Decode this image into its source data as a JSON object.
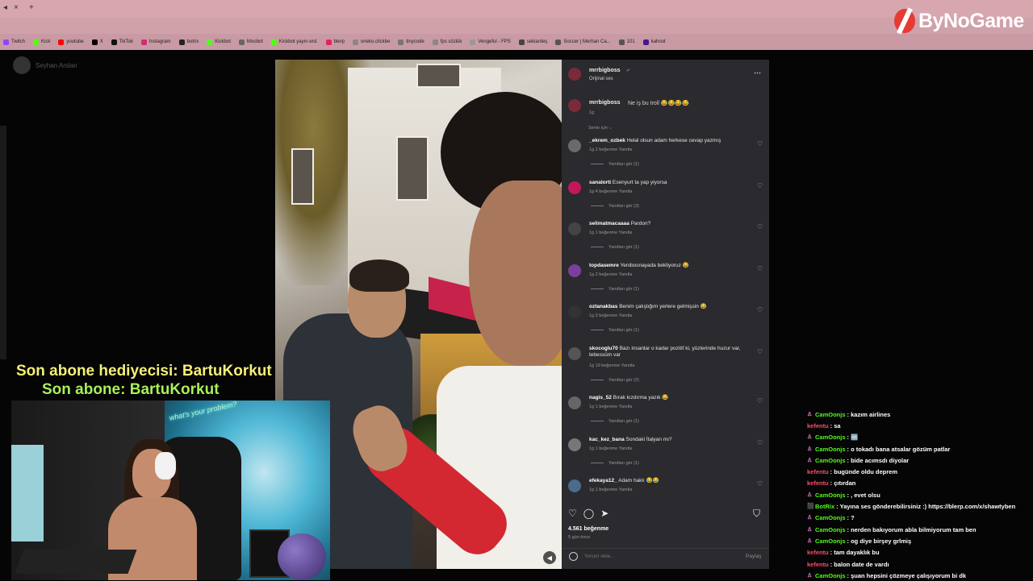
{
  "browser": {
    "tabs": [
      "◂",
      "×",
      "+"
    ],
    "bookmarks": [
      {
        "label": "Twitch",
        "color": "#9146ff"
      },
      {
        "label": "Kick",
        "color": "#53fc18"
      },
      {
        "label": "youtube",
        "color": "#ff0000"
      },
      {
        "label": "X",
        "color": "#000000"
      },
      {
        "label": "TikTok",
        "color": "#111111"
      },
      {
        "label": "Instagram",
        "color": "#d62976"
      },
      {
        "label": "botrix",
        "color": "#222222"
      },
      {
        "label": "Kickbot",
        "color": "#53fc18"
      },
      {
        "label": "Moobot",
        "color": "#666666"
      },
      {
        "label": "Kickbot yayın erd.",
        "color": "#53fc18"
      },
      {
        "label": "blerp",
        "color": "#e91e63"
      },
      {
        "label": "oneko.clickbe",
        "color": "#888888"
      },
      {
        "label": "tinycode",
        "color": "#777777"
      },
      {
        "label": "fps sözlük",
        "color": "#888888"
      },
      {
        "label": "Vengeful - FPS",
        "color": "#999999"
      },
      {
        "label": "sekiardeş",
        "color": "#444444"
      },
      {
        "label": "Soccer | Merhan Ca...",
        "color": "#555555"
      },
      {
        "label": "101",
        "color": "#555555"
      },
      {
        "label": "kahoot",
        "color": "#46178f"
      }
    ]
  },
  "overlay": {
    "brand": "ByNoGame",
    "notice_gifter": "Son abone hediyecisi: BartuKorkut",
    "notice_sub": "Son abone: BartuKorkut",
    "neon_text": "what's your problem?"
  },
  "page_user": "Seyhan Arslan",
  "post": {
    "author": "mrrbigboss",
    "audio": "Orijinal ses",
    "caption_author": "mrrbigboss",
    "caption": "Ne iş bu troll 😂😂😂😂",
    "caption_time": "1g",
    "sort_label": "Senin için ⌵",
    "likes": "4.561 beğenme",
    "time_ago": "5 gün önce",
    "comment_placeholder": "Yorum ekle...",
    "share_label": "Paylaş",
    "comments": [
      {
        "user": "_ekrem_ozbek",
        "text": "Helal olsun adam herkese cevap yazmış",
        "meta": "1g   2 beğenme   Yanıtla",
        "replies": "Yanıtları gör (1)",
        "color": "#6a6a6a"
      },
      {
        "user": "sanalorti",
        "text": "Esenyurt ta yap yiyorsa",
        "meta": "1g   4 beğenme   Yanıtla",
        "replies": "Yanıtları gör (3)",
        "color": "#c2185b"
      },
      {
        "user": "selimatmacaaaa",
        "text": "Pardon?",
        "meta": "1g   1 beğenme   Yanıtla",
        "replies": "Yanıtları gör (1)",
        "color": "#444444"
      },
      {
        "user": "topdasemre",
        "text": "Yenibosnayada bekliyoruz 😂",
        "meta": "1g   2 beğenme   Yanıtla",
        "replies": "Yanıtları gör (1)",
        "color": "#7b3fa0"
      },
      {
        "user": "oztanakbas",
        "text": "Benim çalıştığım yerlere gelmişsin 😂",
        "meta": "1g   3 beğenme   Yanıtla",
        "replies": "Yanıtları gör (1)",
        "color": "#333333"
      },
      {
        "user": "skocoglu70",
        "text": "Bazı insanlar o kadar pozitif ki, yüzlerinde huzur var, tebessüm var",
        "meta": "1g   19 beğenme   Yanıtla",
        "replies": "Yanıtları gör (2)",
        "color": "#555555"
      },
      {
        "user": "nagis_52",
        "text": "Bırak kızdırma yazık 😂",
        "meta": "1g   1 beğenme   Yanıtla",
        "replies": "Yanıtları gör (1)",
        "color": "#666666"
      },
      {
        "user": "kac_kez_bana",
        "text": "Sondaki İtalyan mı?",
        "meta": "1g   1 beğenme   Yanıtla",
        "replies": "Yanıtları gör (1)",
        "color": "#777777"
      },
      {
        "user": "efekaya12_",
        "text": "Adam haklı 😂😂",
        "meta": "1g   1 beğenme   Yanıtla",
        "replies": "",
        "color": "#4a6b8a"
      }
    ]
  },
  "chat": [
    {
      "user": "CamOonjs",
      "text": ": kazım airlines",
      "color": "#53fc18",
      "badge": "♙"
    },
    {
      "user": "kefentu",
      "text": ": sa",
      "color": "#ff4b6e",
      "badge": ""
    },
    {
      "user": "CamOonjs",
      "text": ": 🆒",
      "color": "#53fc18",
      "badge": "♙"
    },
    {
      "user": "CamOonjs",
      "text": ": o tokadı bana atsalar gözüm patlar",
      "color": "#53fc18",
      "badge": "♙"
    },
    {
      "user": "CamOonjs",
      "text": ": bide acımsdı diyolar",
      "color": "#53fc18",
      "badge": "♙"
    },
    {
      "user": "kefentu",
      "text": ": bugünde oldu deprem",
      "color": "#ff4b6e",
      "badge": ""
    },
    {
      "user": "kefentu",
      "text": ": çıtırdan",
      "color": "#ff4b6e",
      "badge": ""
    },
    {
      "user": "CamOonjs",
      "text": ": , evet olsu",
      "color": "#53fc18",
      "badge": "♙"
    },
    {
      "user": "BotRix",
      "text": ": Yayına ses gönderebilirsiniz :) https://blerp.com/x/shawtyben",
      "color": "#53fc18",
      "badge": "⬛"
    },
    {
      "user": "CamOonjs",
      "text": ": ?",
      "color": "#53fc18",
      "badge": "♙"
    },
    {
      "user": "CamOonjs",
      "text": ": nerden bakıyorum abla bilmiyorum tam ben",
      "color": "#53fc18",
      "badge": "♙"
    },
    {
      "user": "CamOonjs",
      "text": ": og diye birşey grlmiş",
      "color": "#53fc18",
      "badge": "♙"
    },
    {
      "user": "kefentu",
      "text": ": tam dayaklık bu",
      "color": "#ff4b6e",
      "badge": ""
    },
    {
      "user": "kefentu",
      "text": ": balon date de vardı",
      "color": "#ff4b6e",
      "badge": ""
    },
    {
      "user": "CamOonjs",
      "text": ": şuan hepsini çözmeye çalışıyorum bi dk",
      "color": "#53fc18",
      "badge": "♙"
    }
  ]
}
